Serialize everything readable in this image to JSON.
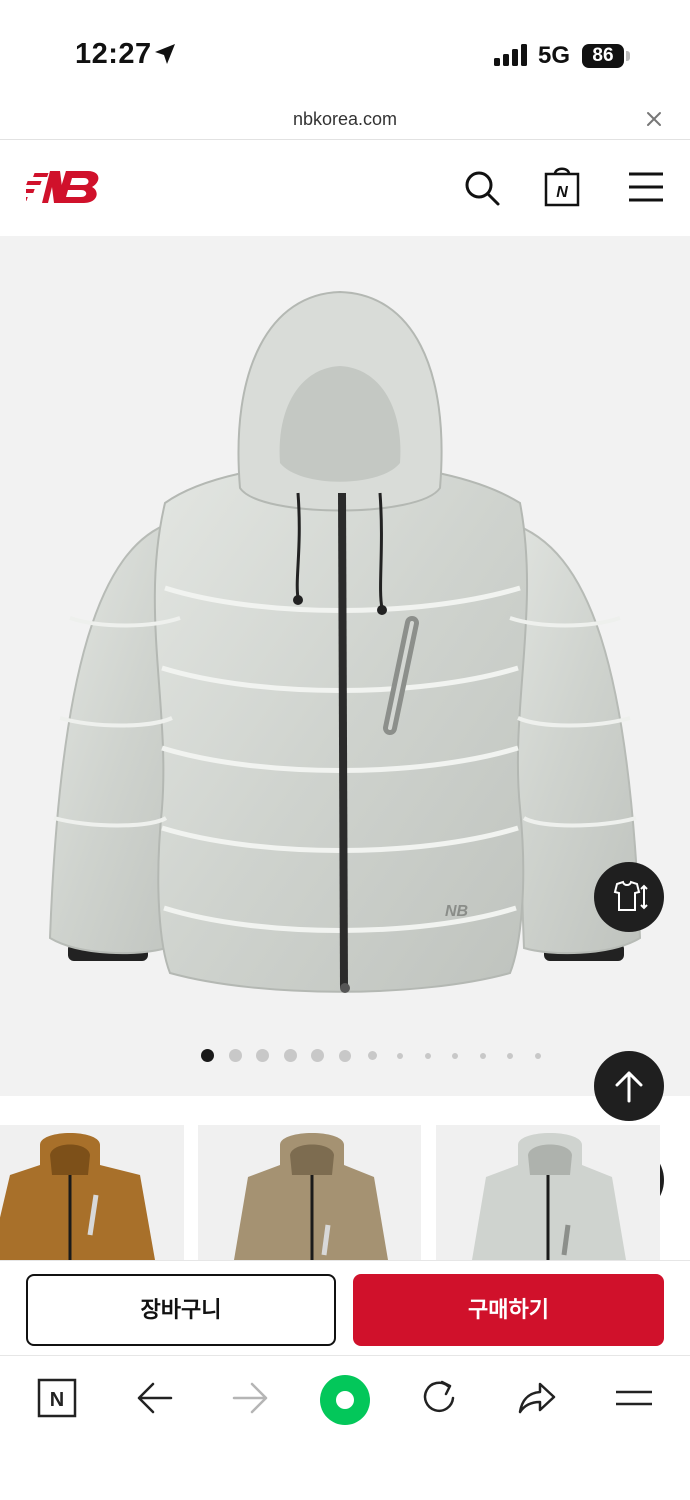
{
  "status_bar": {
    "time": "12:27",
    "network": "5G",
    "battery": "86"
  },
  "url_bar": {
    "domain": "nbkorea.com"
  },
  "header": {
    "logo_icon": "new-balance-logo",
    "icons": [
      "search-icon",
      "shopping-bag-icon",
      "hamburger-menu-icon"
    ],
    "bag_letter": "N"
  },
  "gallery": {
    "image": "light gray hooded down puffer jacket",
    "total_images": 13,
    "active_index": 0,
    "size_guide_icon": "tshirt-size-icon"
  },
  "floating_buttons": [
    "scroll-top-icon",
    "recent-history-icon"
  ],
  "color_options": [
    {
      "color": "#a8702a",
      "name": "brown"
    },
    {
      "color": "#a59272",
      "name": "beige"
    },
    {
      "color": "#cfd3cf",
      "name": "light gray"
    }
  ],
  "actions": {
    "cart_label": "장바구니",
    "buy_label": "구매하기"
  },
  "colors": {
    "brand_red": "#d0112b",
    "fab_dark": "#1f1f1f",
    "jacket_gray": "#d3d6d2"
  },
  "browser_bar": {
    "icons": [
      "naver-home-icon",
      "back-icon",
      "forward-icon",
      "green-dot-icon",
      "reload-icon",
      "share-icon",
      "menu-icon"
    ],
    "home_letter": "N"
  }
}
